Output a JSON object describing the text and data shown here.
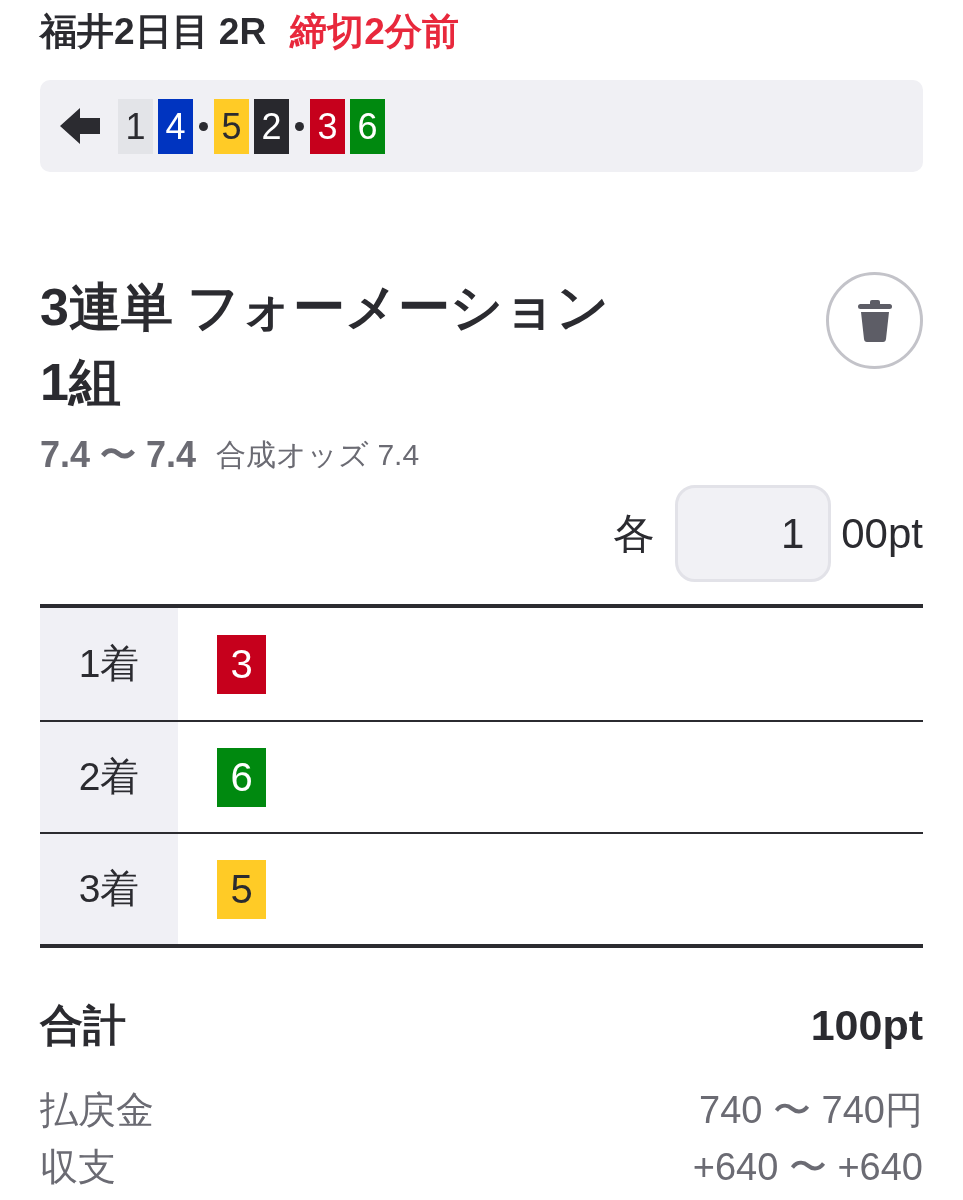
{
  "header": {
    "race": "福井2日目 2R",
    "deadline": "締切2分前"
  },
  "selection": {
    "groups": [
      {
        "chips": [
          {
            "number": "1",
            "color": "#e3e4e8"
          },
          {
            "number": "4",
            "color": "#0034c0"
          }
        ]
      },
      {
        "chips": [
          {
            "number": "5",
            "color": "#ffcb26"
          },
          {
            "number": "2",
            "color": "#28282d"
          }
        ]
      },
      {
        "chips": [
          {
            "number": "3",
            "color": "#c6001c"
          },
          {
            "number": "6",
            "color": "#00890f"
          }
        ]
      }
    ]
  },
  "bet": {
    "title": "3連単 フォーメーション",
    "count": "1組",
    "odds_range": "7.4 〜 7.4",
    "combined_odds": "合成オッズ 7.4"
  },
  "amount": {
    "prefix": "各",
    "value": "1",
    "suffix": "00pt"
  },
  "table": {
    "rows": [
      {
        "label": "1着",
        "chips": [
          {
            "number": "3",
            "color": "#c6001c"
          }
        ]
      },
      {
        "label": "2着",
        "chips": [
          {
            "number": "6",
            "color": "#00890f"
          }
        ]
      },
      {
        "label": "3着",
        "chips": [
          {
            "number": "5",
            "color": "#ffcb26"
          }
        ]
      }
    ]
  },
  "summary": {
    "total": {
      "label": "合計",
      "value": "100pt"
    },
    "rows": [
      {
        "label": "払戻金",
        "value": "740 〜 740円"
      },
      {
        "label": "収支",
        "value": "+640 〜 +640"
      }
    ]
  }
}
